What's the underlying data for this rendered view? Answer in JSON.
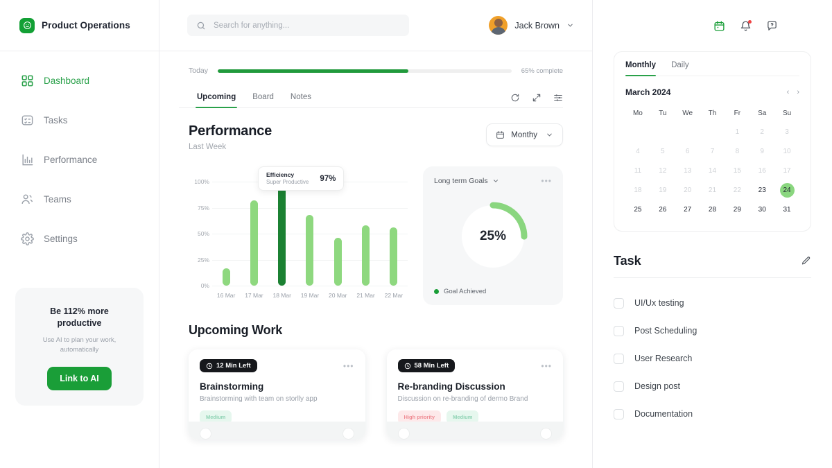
{
  "brand": {
    "name": "Product Operations",
    "logo_icon": "smiley-circle-icon",
    "accent": "#13a035"
  },
  "sidebar": {
    "items": [
      {
        "label": "Dashboard",
        "icon": "grid-icon",
        "active": true
      },
      {
        "label": "Tasks",
        "icon": "checklist-icon",
        "active": false
      },
      {
        "label": "Performance",
        "icon": "bar-chart-icon",
        "active": false
      },
      {
        "label": "Teams",
        "icon": "users-icon",
        "active": false
      },
      {
        "label": "Settings",
        "icon": "gear-icon",
        "active": false
      }
    ],
    "promo": {
      "title": "Be 112% more productive",
      "subtitle": "Use AI to plan your work, automatically",
      "button": "Link to AI"
    }
  },
  "topbar": {
    "search_placeholder": "Search for anything...",
    "search_value": "",
    "search_icon": "search-icon",
    "user_name": "Jack Brown",
    "user_caret_icon": "chevron-down-icon"
  },
  "progress": {
    "label": "Today",
    "percent": 65,
    "percent_text": "65% complete"
  },
  "tabs": {
    "items": [
      {
        "label": "Upcoming",
        "active": true
      },
      {
        "label": "Board",
        "active": false
      },
      {
        "label": "Notes",
        "active": false
      }
    ],
    "icons": [
      "refresh-icon",
      "expand-icon",
      "filter-sliders-icon"
    ]
  },
  "performance": {
    "title": "Performance",
    "subtitle": "Last Week",
    "period_value": "Monthy",
    "period_icon": "calendar-icon",
    "period_caret_icon": "chevron-down-icon",
    "tooltip": {
      "label": "Efficiency",
      "sublabel": "Super Productive",
      "value": "97%"
    }
  },
  "chart_data": {
    "type": "bar",
    "title": "Performance",
    "subtitle": "Last Week",
    "categories": [
      "16 Mar",
      "17 Mar",
      "18 Mar",
      "19 Mar",
      "20 Mar",
      "21 Mar",
      "22 Mar"
    ],
    "values": [
      17,
      82,
      97,
      68,
      46,
      58,
      56
    ],
    "highlight_index": 2,
    "highlight_value": 97,
    "bar_color": "#8ed87f",
    "highlight_color": "#1b8132",
    "ylabel": "",
    "xlabel": "",
    "ylim": [
      0,
      100
    ],
    "yticks": [
      0,
      25,
      50,
      75,
      100
    ],
    "ytick_labels": [
      "0%",
      "25%",
      "50%",
      "75%",
      "100%"
    ],
    "grid": true,
    "legend": "none"
  },
  "goals": {
    "title": "Long term Goals",
    "caret_icon": "chevron-down-icon",
    "menu_icon": "ellipsis-icon",
    "percent": 25,
    "percent_text": "25%",
    "legend_label": "Goal Achieved",
    "legend_color": "#1a9e38",
    "ring_color": "#8ad67f"
  },
  "upcoming_work": {
    "title": "Upcoming Work",
    "cards": [
      {
        "time": "12 Min Left",
        "clock_icon": "clock-icon",
        "menu_icon": "ellipsis-icon",
        "title": "Brainstorming",
        "desc": "Brainstorming with team on storlly app",
        "tags": [
          {
            "label": "Medium",
            "kind": "medium"
          }
        ]
      },
      {
        "time": "58 Min Left",
        "clock_icon": "clock-icon",
        "menu_icon": "ellipsis-icon",
        "title": "Re-branding Discussion",
        "desc": "Discussion on re-branding of dermo Brand",
        "tags": [
          {
            "label": "High priority",
            "kind": "high"
          },
          {
            "label": "Medium",
            "kind": "medium"
          }
        ]
      }
    ]
  },
  "right_panel": {
    "icons": [
      {
        "name": "calendar-icon",
        "active": true
      },
      {
        "name": "bell-icon",
        "badge": true
      },
      {
        "name": "help-chat-icon",
        "badge": false
      }
    ],
    "calendar": {
      "tabs": [
        {
          "label": "Monthly",
          "active": true
        },
        {
          "label": "Daily",
          "active": false
        }
      ],
      "month": "March 2024",
      "prev_icon": "chevron-left-icon",
      "next_icon": "chevron-right-icon",
      "dow": [
        "Mo",
        "Tu",
        "We",
        "Th",
        "Fr",
        "Sa",
        "Su"
      ],
      "lead_blanks": 4,
      "days": [
        {
          "n": 1,
          "state": "muted"
        },
        {
          "n": 2,
          "state": "muted"
        },
        {
          "n": 3,
          "state": "muted"
        },
        {
          "n": 4,
          "state": "muted"
        },
        {
          "n": 5,
          "state": "muted"
        },
        {
          "n": 6,
          "state": "muted"
        },
        {
          "n": 7,
          "state": "muted"
        },
        {
          "n": 8,
          "state": "muted"
        },
        {
          "n": 9,
          "state": "muted"
        },
        {
          "n": 10,
          "state": "muted"
        },
        {
          "n": 11,
          "state": "muted"
        },
        {
          "n": 12,
          "state": "muted"
        },
        {
          "n": 13,
          "state": "muted"
        },
        {
          "n": 14,
          "state": "muted"
        },
        {
          "n": 15,
          "state": "muted"
        },
        {
          "n": 16,
          "state": "muted"
        },
        {
          "n": 17,
          "state": "muted"
        },
        {
          "n": 18,
          "state": "muted"
        },
        {
          "n": 19,
          "state": "muted"
        },
        {
          "n": 20,
          "state": "muted"
        },
        {
          "n": 21,
          "state": "muted"
        },
        {
          "n": 22,
          "state": "muted"
        },
        {
          "n": 23,
          "state": "normal"
        },
        {
          "n": 24,
          "state": "selected"
        },
        {
          "n": 25,
          "state": "normal"
        },
        {
          "n": 26,
          "state": "normal"
        },
        {
          "n": 27,
          "state": "normal"
        },
        {
          "n": 28,
          "state": "normal"
        },
        {
          "n": 29,
          "state": "normal"
        },
        {
          "n": 30,
          "state": "normal"
        },
        {
          "n": 31,
          "state": "normal"
        }
      ]
    },
    "task": {
      "title": "Task",
      "edit_icon": "pencil-icon",
      "items": [
        {
          "label": "UI/Ux testing",
          "checked": false
        },
        {
          "label": "Post Scheduling",
          "checked": false
        },
        {
          "label": "User Research",
          "checked": false
        },
        {
          "label": "Design post",
          "checked": false
        },
        {
          "label": "Documentation",
          "checked": false
        }
      ]
    }
  }
}
